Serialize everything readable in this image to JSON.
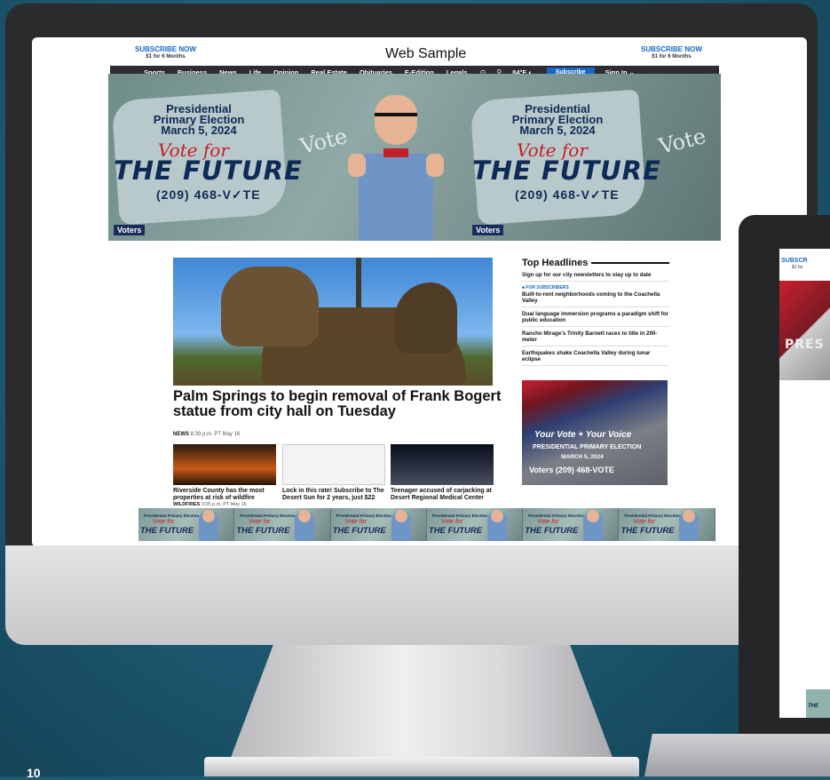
{
  "site": {
    "title": "Web Sample",
    "subscribe_left": "SUBSCRIBE NOW",
    "subscribe_left_note": "$1 for 6 Months",
    "subscribe_right": "SUBSCRIBE NOW",
    "subscribe_right_note": "$1 for 6 Months"
  },
  "nav": {
    "items": [
      "Sports",
      "Business",
      "News",
      "Life",
      "Opinion",
      "Real Estate",
      "Obituaries",
      "E-Edition",
      "Legals"
    ],
    "temperature": "84°F",
    "subscribe": "Subscribe",
    "sign_in": "Sign In ⌄"
  },
  "hero_ad": {
    "line1": "Presidential Primary Election March 5, 2024",
    "vote_for": "Vote for",
    "future": "THE FUTURE",
    "phone": "(209) 468-V✓TE",
    "chalk": "Vote",
    "logo": "Voters"
  },
  "main_story": {
    "headline": "Palm Springs to begin removal of Frank Bogert statue from city hall on Tuesday",
    "section": "NEWS",
    "time": "8:39 p.m. PT May 16"
  },
  "sub_stories": [
    {
      "title": "Riverside County has the most properties at risk of wildfire",
      "section": "WILDFIRES",
      "time": "3:05 p.m. PT May 16"
    },
    {
      "title": "Lock in this rate! Subscribe to The Desert Sun for 2 years, just $22",
      "section": "",
      "time": ""
    },
    {
      "title": "Teenager accused of carjacking at Desert Regional Medical Center",
      "section": "",
      "time": ""
    }
  ],
  "sidebar": {
    "title": "Top Headlines",
    "items": [
      {
        "tag": "",
        "text": "Sign up for our city newsletters to stay up to date"
      },
      {
        "tag": "■ FOR SUBSCRIBERS",
        "text": "Built-to-rent neighborhoods coming to the Coachella Valley"
      },
      {
        "tag": "",
        "text": "Dual language immersion programs a paradigm shift for public education"
      },
      {
        "tag": "",
        "text": "Rancho Mirage's Trinity Barnett races to title in 200-meter"
      },
      {
        "tag": "",
        "text": "Earthquakes shake Coachella Valley during lunar eclipse"
      }
    ],
    "ad": {
      "line1": "Your Vote + Your Voice",
      "line2": "PRESIDENTIAL PRIMARY ELECTION",
      "line3": "MARCH 5, 2024",
      "phone": "Voters (209) 468-VOTE"
    }
  },
  "leaderboard": {
    "title": "Presidential Primary Election",
    "vote_for": "Vote for",
    "future": "THE FUTURE"
  },
  "laptop": {
    "subscribe": "SUBSCR",
    "note": "$1 for",
    "banner_text": "PRES",
    "ad_text": "THE"
  },
  "colors": {
    "accent_blue": "#1469c7",
    "nav_bg": "#2d2d31",
    "ad_navy": "#0e2a57",
    "ad_red": "#c42027",
    "background": "#1f5a73"
  },
  "icons": {
    "nav_circle": "chevron-circle-icon",
    "search": "search-icon",
    "weather": "moon-icon"
  },
  "corner_mark": "10"
}
